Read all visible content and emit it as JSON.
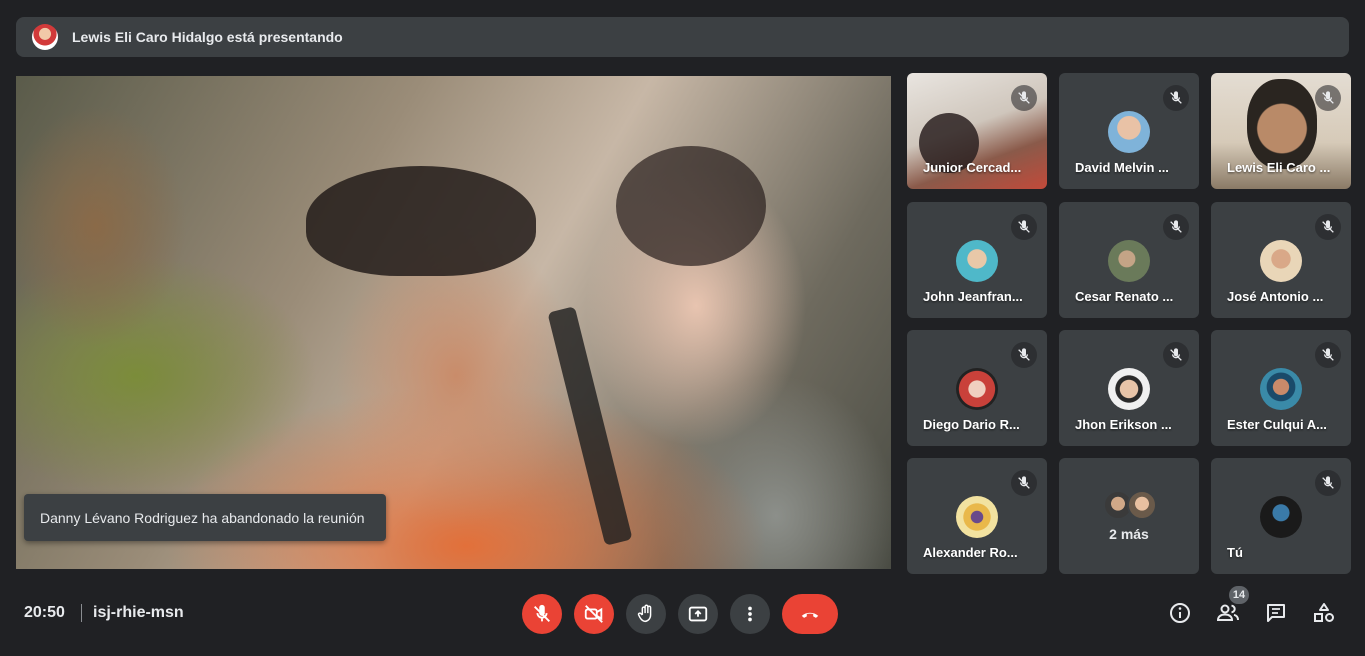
{
  "banner": {
    "text": "Lewis Eli Caro Hidalgo está presentando"
  },
  "toast": {
    "text": "Danny Lévano Rodriguez ha abandonado la reunión"
  },
  "tiles": [
    {
      "name": "Junior Cercad...",
      "type": "video"
    },
    {
      "name": "David Melvin ...",
      "type": "avatar",
      "avatar_color": "#7fb3d9"
    },
    {
      "name": "Lewis Eli Caro ...",
      "type": "video"
    },
    {
      "name": "John Jeanfran...",
      "type": "avatar",
      "avatar_color": "#4fb8c9"
    },
    {
      "name": "Cesar Renato ...",
      "type": "avatar",
      "avatar_color": "#6a7a5a"
    },
    {
      "name": "José Antonio ...",
      "type": "avatar",
      "avatar_color": "#e9d6b8"
    },
    {
      "name": "Diego Dario R...",
      "type": "avatar",
      "avatar_color": "#c9413a"
    },
    {
      "name": "Jhon Erikson ...",
      "type": "avatar",
      "avatar_color": "#f0f0f0"
    },
    {
      "name": "Ester Culqui A...",
      "type": "avatar",
      "avatar_color": "#3a8aa8"
    },
    {
      "name": "Alexander Ro...",
      "type": "avatar",
      "avatar_color": "#f2e2a0"
    },
    {
      "name": "2 más",
      "type": "more"
    },
    {
      "name": "Tú",
      "type": "avatar",
      "avatar_color": "#1a1a1a"
    }
  ],
  "footer": {
    "time": "20:50",
    "meeting_code": "isj-rhie-msn",
    "participants_count": "14"
  },
  "colors": {
    "background": "#202124",
    "tile": "#3c4043",
    "danger": "#ea4335"
  }
}
